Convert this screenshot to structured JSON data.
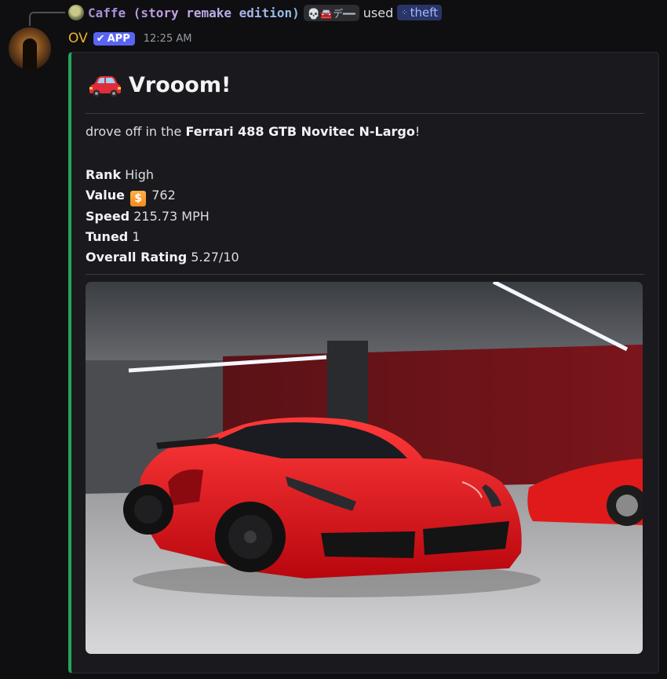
{
  "reply": {
    "display_name": "Caffe (story remake edition)",
    "tag": "💀🚘デ━━",
    "used_label": "used",
    "command": "theft"
  },
  "message": {
    "username": "OV",
    "app_badge": "APP",
    "timestamp": "12:25 AM"
  },
  "embed": {
    "accent_color": "#23a55a",
    "title": "Vrooom!",
    "title_icon": "red-car-icon",
    "description_prefix": "drove off in the ",
    "car_name": "Ferrari 488 GTB Novitec N-Largo",
    "description_suffix": "!",
    "fields": [
      {
        "key": "Rank",
        "value": "High"
      },
      {
        "key": "Value",
        "value": "762",
        "icon": "coin-icon"
      },
      {
        "key": "Speed",
        "value": "215.73 MPH"
      },
      {
        "key": "Tuned",
        "value": "1"
      },
      {
        "key": "Overall Rating",
        "value": "5.27/10"
      }
    ]
  }
}
